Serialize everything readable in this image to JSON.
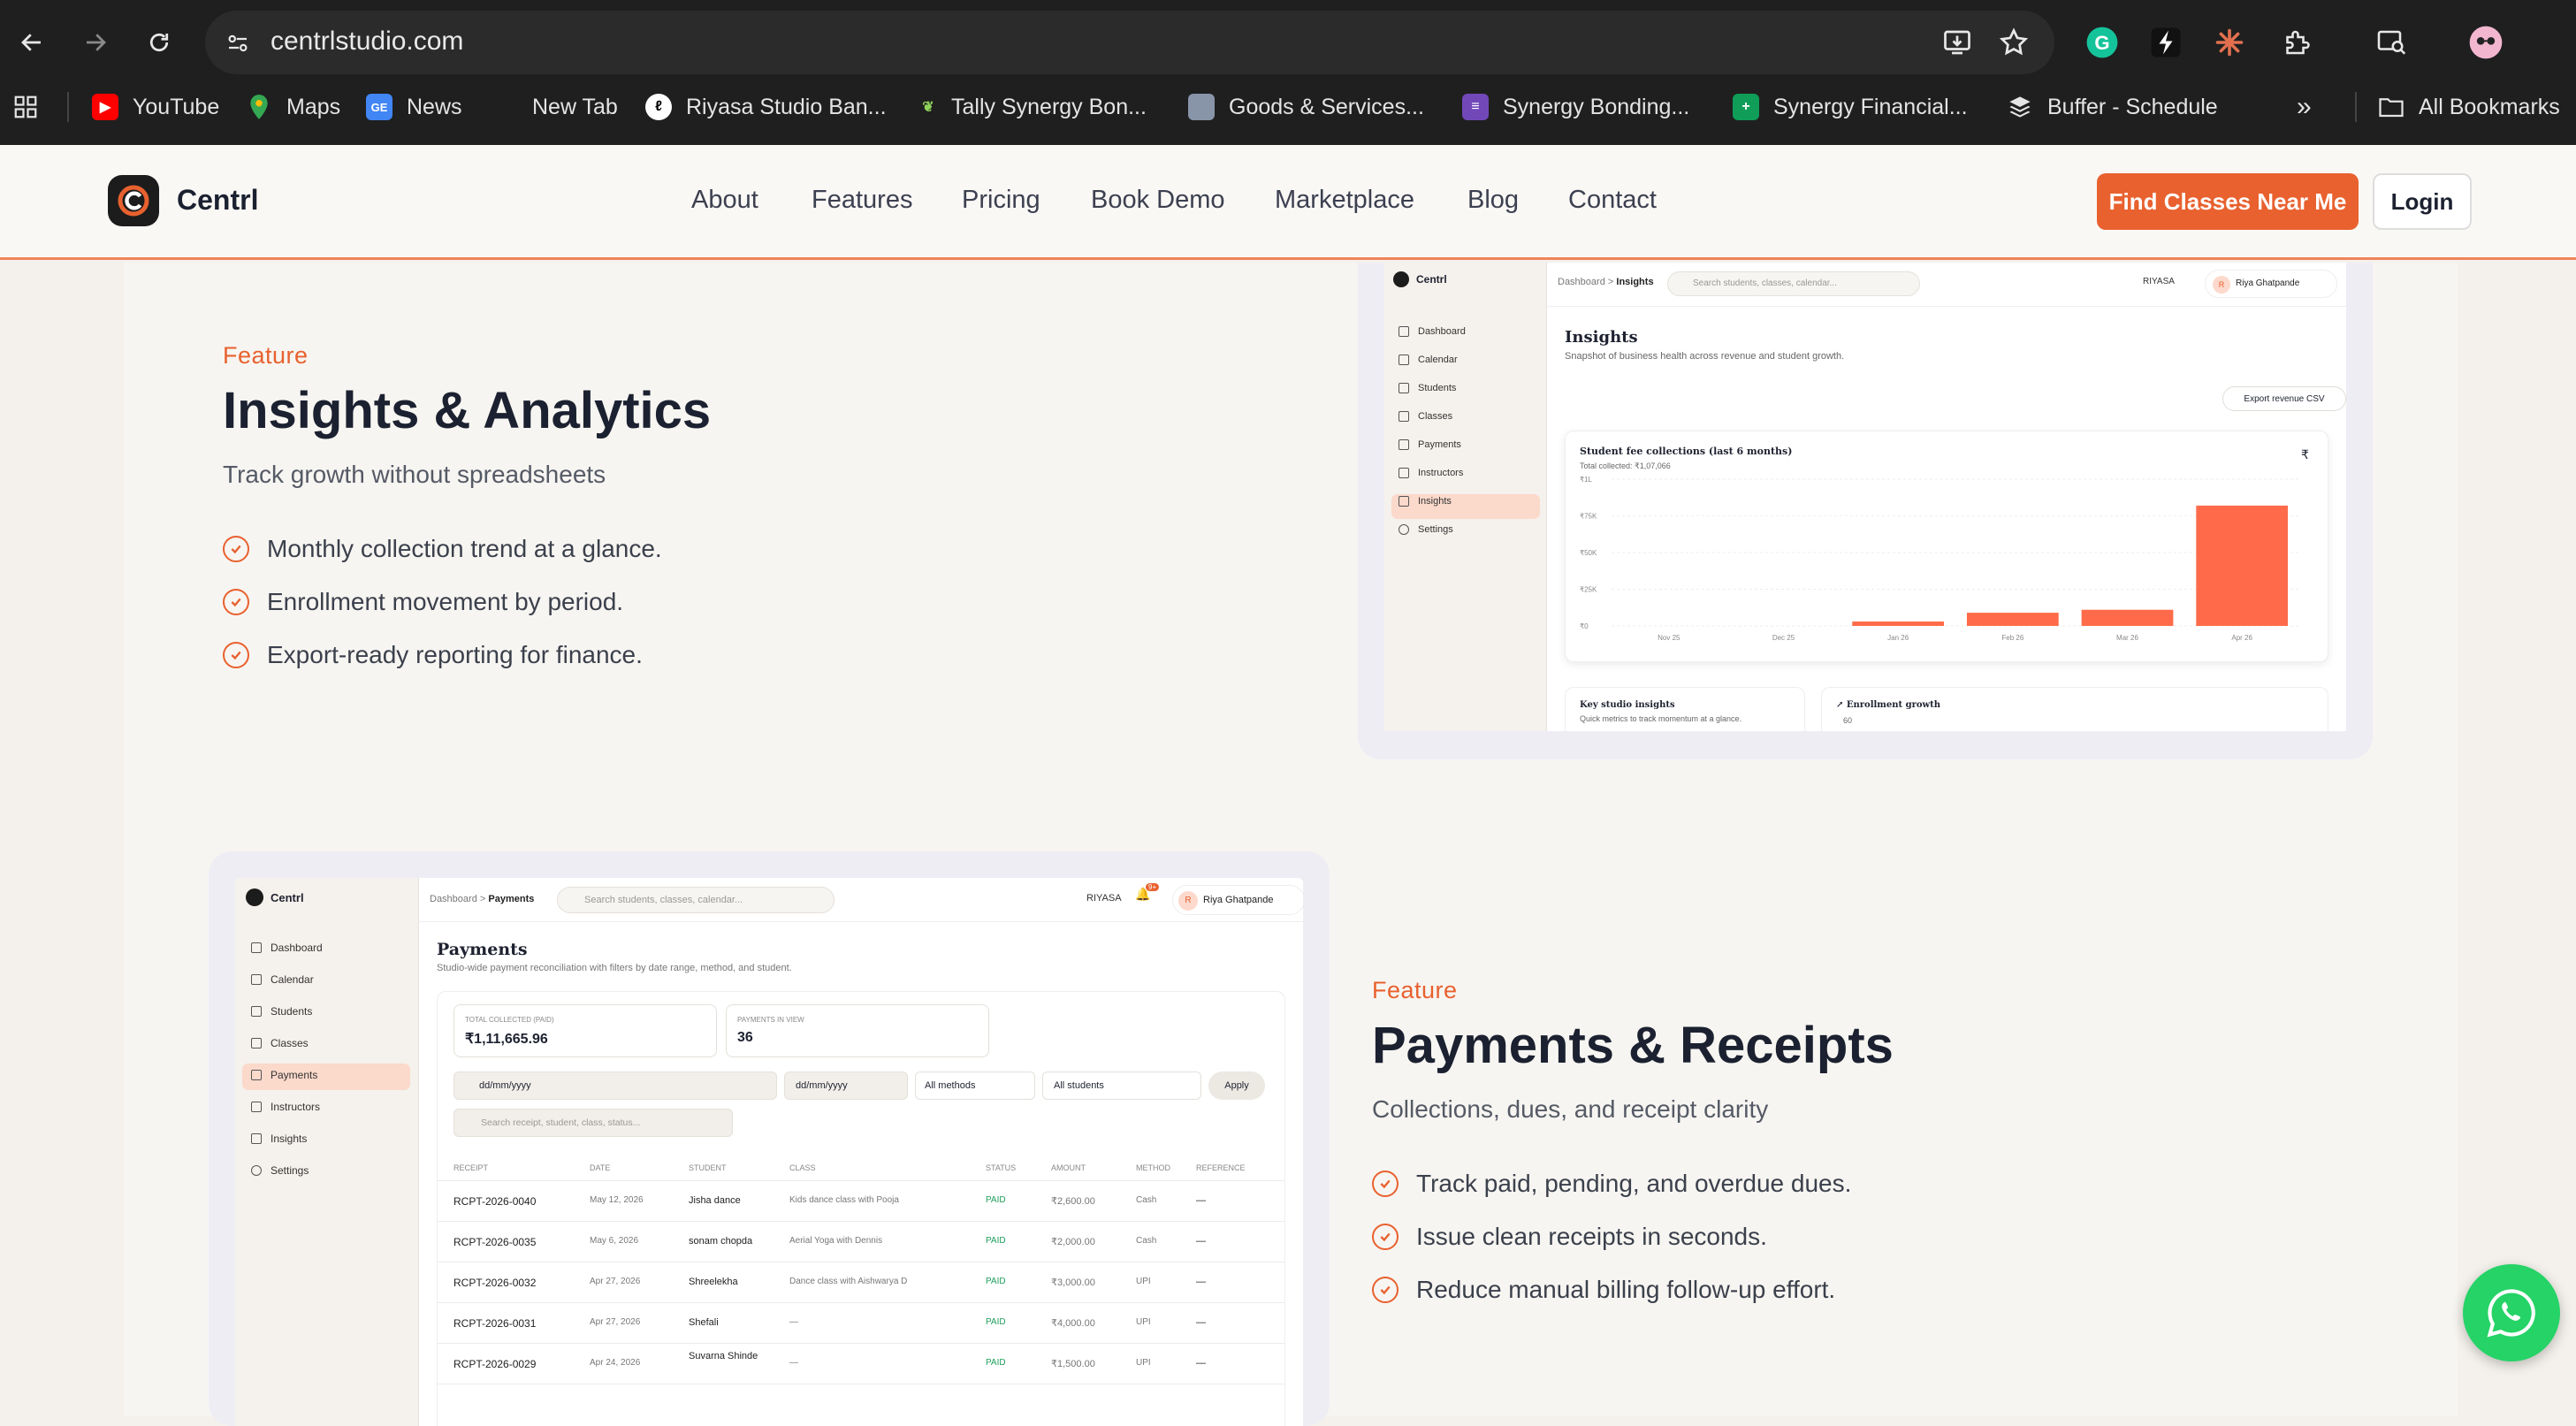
{
  "browser": {
    "url": "centrlstudio.com",
    "bookmarks": [
      "YouTube",
      "Maps",
      "News",
      "New Tab",
      "Riyasa Studio Ban...",
      "Tally Synergy Bon...",
      "Goods & Services...",
      "Synergy Bonding...",
      "Synergy Financial...",
      "Buffer - Schedule"
    ],
    "more": "»",
    "all_bookmarks": "All Bookmarks"
  },
  "site": {
    "brand": "Centrl",
    "nav": [
      "About",
      "Features",
      "Pricing",
      "Book Demo",
      "Marketplace",
      "Blog",
      "Contact"
    ],
    "cta": "Find Classes Near Me",
    "login": "Login",
    "accent": "#e8612f"
  },
  "insights": {
    "eyebrow": "Feature",
    "title": "Insights & Analytics",
    "subtitle": "Track growth without spreadsheets",
    "bullets": [
      "Monthly collection trend at a glance.",
      "Enrollment movement by period.",
      "Export-ready reporting for finance."
    ],
    "mock": {
      "brand": "Centrl",
      "crumb_root": "Dashboard",
      "crumb_sep": ">",
      "crumb_page": "Insights",
      "search": "Search students, classes, calendar...",
      "studio": "RIYASA",
      "avatar": "R",
      "user": "Riya Ghatpande",
      "sidebar": [
        "Dashboard",
        "Calendar",
        "Students",
        "Classes",
        "Payments",
        "Instructors",
        "Insights",
        "Settings"
      ],
      "page_title": "Insights",
      "page_sub": "Snapshot of business health across revenue and student growth.",
      "export_btn": "Export revenue CSV",
      "chart_title": "Student fee collections (last 6 months)",
      "chart_sub": "Total collected: ₹1,07,066",
      "currency_icon": "₹",
      "card1_title": "Key studio insights",
      "card1_sub": "Quick metrics to track momentum at a glance.",
      "card2_title": "Enrollment growth",
      "card2_value": "60"
    }
  },
  "chart_data": {
    "type": "bar",
    "title": "Student fee collections (last 6 months)",
    "categories": [
      "Nov 25",
      "Dec 25",
      "Jan 26",
      "Feb 26",
      "Mar 26",
      "Apr 26"
    ],
    "values": [
      0,
      0,
      3000,
      9000,
      11000,
      82000
    ],
    "yticks": [
      "₹0",
      "₹25K",
      "₹50K",
      "₹75K",
      "₹1L"
    ],
    "ylim": [
      0,
      100000
    ],
    "grid": true,
    "color": "#ff6b4a"
  },
  "payments": {
    "eyebrow": "Feature",
    "title": "Payments & Receipts",
    "subtitle": "Collections, dues, and receipt clarity",
    "bullets": [
      "Track paid, pending, and overdue dues.",
      "Issue clean receipts in seconds.",
      "Reduce manual billing follow-up effort."
    ],
    "mock": {
      "brand": "Centrl",
      "crumb_root": "Dashboard",
      "crumb_sep": ">",
      "crumb_page": "Payments",
      "search": "Search students, classes, calendar...",
      "studio": "RIYASA",
      "avatar": "R",
      "user": "Riya Ghatpande",
      "bell_badge": "9+",
      "sidebar": [
        "Dashboard",
        "Calendar",
        "Students",
        "Classes",
        "Payments",
        "Instructors",
        "Insights",
        "Settings"
      ],
      "page_title": "Payments",
      "page_sub": "Studio-wide payment reconciliation with filters by date range, method, and student.",
      "stat1_label": "TOTAL COLLECTED (PAID)",
      "stat1_value": "₹1,11,665.96",
      "stat2_label": "PAYMENTS IN VIEW",
      "stat2_value": "36",
      "date_from": "dd/mm/yyyy",
      "date_to": "dd/mm/yyyy",
      "methods": "All methods",
      "students": "All students",
      "apply": "Apply",
      "receipt_search": "Search receipt, student, class, status...",
      "columns": [
        "RECEIPT",
        "DATE",
        "STUDENT",
        "CLASS",
        "STATUS",
        "AMOUNT",
        "METHOD",
        "REFERENCE"
      ],
      "rows": [
        [
          "RCPT-2026-0040",
          "May 12, 2026",
          "Jisha dance",
          "Kids dance class with Pooja",
          "PAID",
          "₹2,600.00",
          "Cash",
          "—"
        ],
        [
          "RCPT-2026-0035",
          "May 6, 2026",
          "sonam chopda",
          "Aerial Yoga with Dennis",
          "PAID",
          "₹2,000.00",
          "Cash",
          "—"
        ],
        [
          "RCPT-2026-0032",
          "Apr 27, 2026",
          "Shreelekha",
          "Dance class with Aishwarya D",
          "PAID",
          "₹3,000.00",
          "UPI",
          "—"
        ],
        [
          "RCPT-2026-0031",
          "Apr 27, 2026",
          "Shefali",
          "—",
          "PAID",
          "₹4,000.00",
          "UPI",
          "—"
        ],
        [
          "RCPT-2026-0029",
          "Apr 24, 2026",
          "Suvarna Shinde",
          "—",
          "PAID",
          "₹1,500.00",
          "UPI",
          "—"
        ]
      ]
    }
  }
}
